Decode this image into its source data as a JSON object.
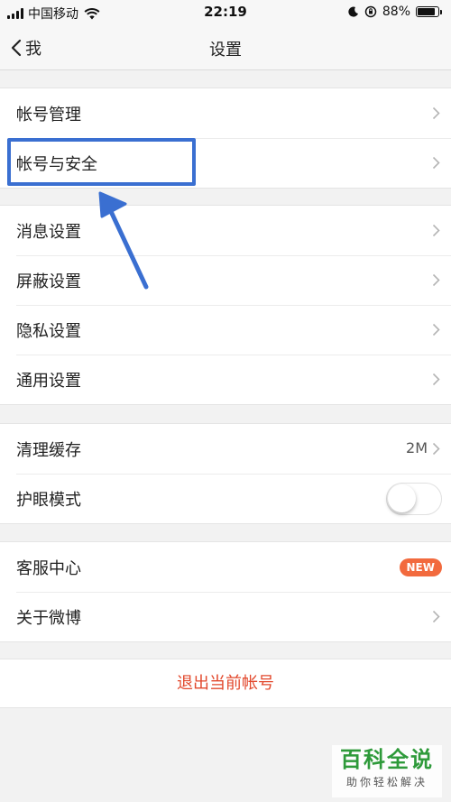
{
  "status_bar": {
    "carrier": "中国移动",
    "time": "22:19",
    "battery": "88%",
    "battery_level": 0.88
  },
  "nav": {
    "back_label": "我",
    "title": "设置"
  },
  "groups": [
    {
      "items": [
        {
          "label": "帐号管理"
        },
        {
          "label": "帐号与安全"
        }
      ]
    },
    {
      "items": [
        {
          "label": "消息设置"
        },
        {
          "label": "屏蔽设置"
        },
        {
          "label": "隐私设置"
        },
        {
          "label": "通用设置"
        }
      ]
    },
    {
      "items": [
        {
          "label": "清理缓存",
          "value": "2M"
        },
        {
          "label": "护眼模式",
          "toggle": false
        }
      ]
    },
    {
      "items": [
        {
          "label": "客服中心",
          "badge": "NEW"
        },
        {
          "label": "关于微博"
        }
      ]
    }
  ],
  "logout_label": "退出当前帐号",
  "watermark": {
    "title": "百科全说",
    "subtitle": "助你轻松解决"
  },
  "colors": {
    "accent_red": "#e2482c",
    "badge": "#f26a3e",
    "annotation": "#3a6fd1",
    "watermark": "#2e9a3a"
  }
}
